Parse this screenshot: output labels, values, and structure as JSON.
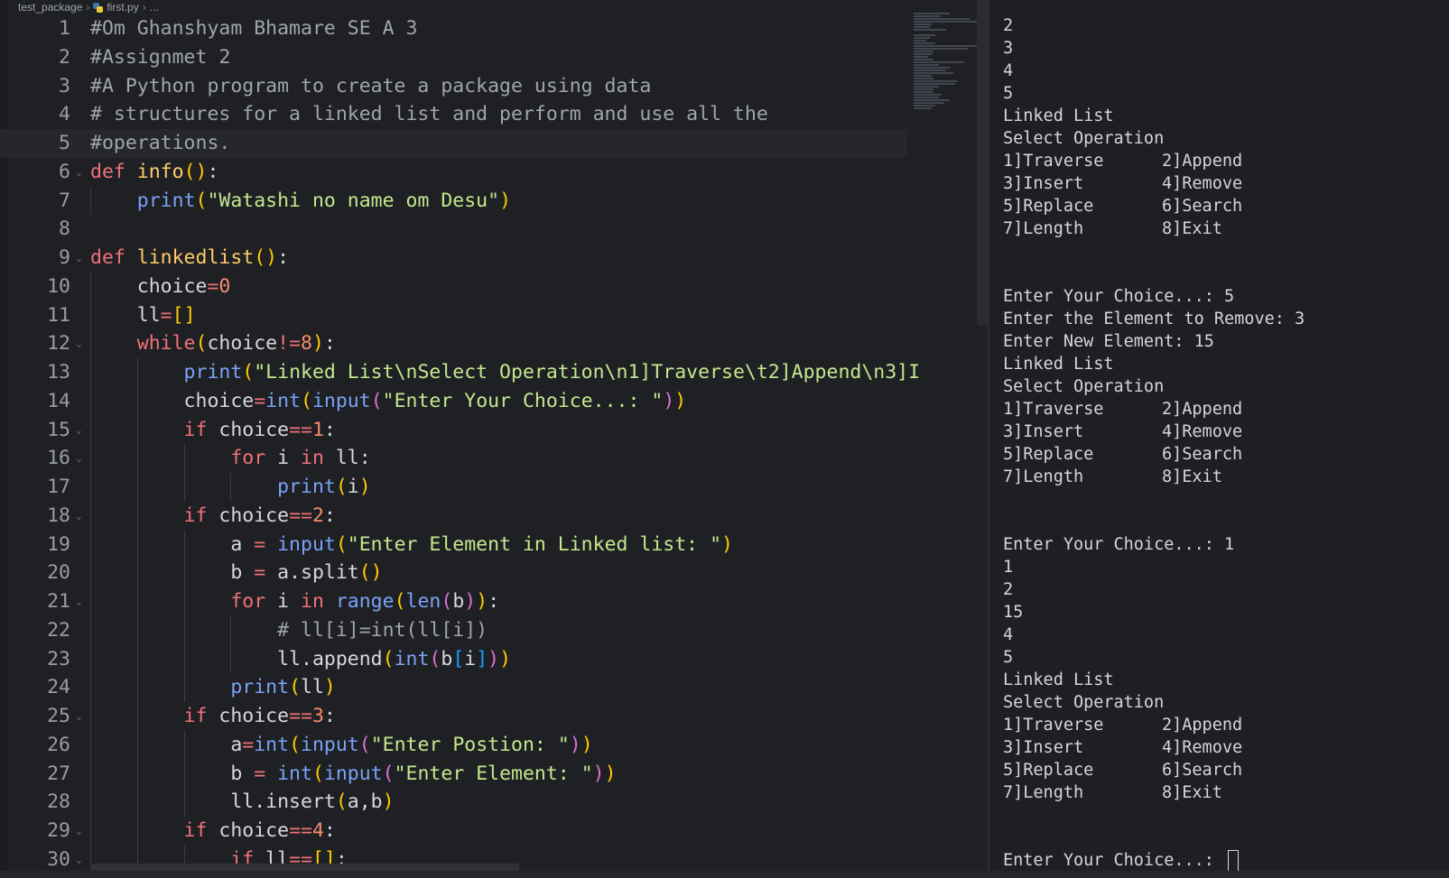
{
  "breadcrumb": {
    "folder": "test_package",
    "file": "first.py",
    "more": "..."
  },
  "colors": {
    "editor_bg": "#1f2024",
    "keyword": "#f07178",
    "function": "#ffcc66",
    "builtin": "#7aa2f7",
    "string": "#c3e88d",
    "number": "#f78c6c",
    "comment": "#a0a4ad"
  },
  "code_lines": [
    {
      "n": "1",
      "tokens": [
        {
          "t": "#Om Ghanshyam Bhamare SE A 3",
          "c": "cm"
        }
      ]
    },
    {
      "n": "2",
      "tokens": [
        {
          "t": "#Assignmet 2",
          "c": "cm"
        }
      ]
    },
    {
      "n": "3",
      "tokens": [
        {
          "t": "#A Python program to create a package using data",
          "c": "cm"
        }
      ]
    },
    {
      "n": "4",
      "tokens": [
        {
          "t": "# structures for a linked list and perform and use all the",
          "c": "cm"
        }
      ]
    },
    {
      "n": "5",
      "current": true,
      "tokens": [
        {
          "t": "#operations.",
          "c": "cm"
        }
      ]
    },
    {
      "n": "6",
      "fold": true,
      "tokens": [
        {
          "t": "def ",
          "c": "kw"
        },
        {
          "t": "info",
          "c": "fn"
        },
        {
          "t": "()",
          "c": "p1"
        },
        {
          "t": ":",
          "c": ""
        }
      ]
    },
    {
      "n": "7",
      "indent": 1,
      "tokens": [
        {
          "t": "    print",
          "c": "bi"
        },
        {
          "t": "(",
          "c": "p1"
        },
        {
          "t": "\"Watashi no name om Desu\"",
          "c": "st"
        },
        {
          "t": ")",
          "c": "p1"
        }
      ]
    },
    {
      "n": "8",
      "tokens": []
    },
    {
      "n": "9",
      "fold": true,
      "tokens": [
        {
          "t": "def ",
          "c": "kw"
        },
        {
          "t": "linkedlist",
          "c": "fn"
        },
        {
          "t": "()",
          "c": "p1"
        },
        {
          "t": ":",
          "c": ""
        }
      ]
    },
    {
      "n": "10",
      "indent": 1,
      "tokens": [
        {
          "t": "    choice",
          "c": ""
        },
        {
          "t": "=",
          "c": "op"
        },
        {
          "t": "0",
          "c": "num"
        }
      ]
    },
    {
      "n": "11",
      "indent": 1,
      "tokens": [
        {
          "t": "    ll",
          "c": ""
        },
        {
          "t": "=",
          "c": "op"
        },
        {
          "t": "[]",
          "c": "p1"
        }
      ]
    },
    {
      "n": "12",
      "indent": 1,
      "fold": true,
      "tokens": [
        {
          "t": "    while",
          "c": "kw"
        },
        {
          "t": "(",
          "c": "p1"
        },
        {
          "t": "choice",
          "c": ""
        },
        {
          "t": "!=",
          "c": "op"
        },
        {
          "t": "8",
          "c": "num"
        },
        {
          "t": ")",
          "c": "p1"
        },
        {
          "t": ":",
          "c": ""
        }
      ]
    },
    {
      "n": "13",
      "indent": 2,
      "tokens": [
        {
          "t": "        print",
          "c": "bi"
        },
        {
          "t": "(",
          "c": "p1"
        },
        {
          "t": "\"Linked List\\nSelect Operation\\n1]Traverse\\t2]Append\\n3]I",
          "c": "st"
        }
      ]
    },
    {
      "n": "14",
      "indent": 2,
      "tokens": [
        {
          "t": "        choice",
          "c": ""
        },
        {
          "t": "=",
          "c": "op"
        },
        {
          "t": "int",
          "c": "bi"
        },
        {
          "t": "(",
          "c": "p1"
        },
        {
          "t": "input",
          "c": "bi"
        },
        {
          "t": "(",
          "c": "p2"
        },
        {
          "t": "\"Enter Your Choice...: \"",
          "c": "st"
        },
        {
          "t": ")",
          "c": "p2"
        },
        {
          "t": ")",
          "c": "p1"
        }
      ]
    },
    {
      "n": "15",
      "indent": 2,
      "fold": true,
      "tokens": [
        {
          "t": "        if ",
          "c": "kw"
        },
        {
          "t": "choice",
          "c": ""
        },
        {
          "t": "==",
          "c": "op"
        },
        {
          "t": "1",
          "c": "num"
        },
        {
          "t": ":",
          "c": ""
        }
      ]
    },
    {
      "n": "16",
      "indent": 3,
      "fold": true,
      "tokens": [
        {
          "t": "            for ",
          "c": "kw"
        },
        {
          "t": "i ",
          "c": ""
        },
        {
          "t": "in ",
          "c": "kw"
        },
        {
          "t": "ll:",
          "c": ""
        }
      ]
    },
    {
      "n": "17",
      "indent": 4,
      "tokens": [
        {
          "t": "                print",
          "c": "bi"
        },
        {
          "t": "(",
          "c": "p1"
        },
        {
          "t": "i",
          "c": ""
        },
        {
          "t": ")",
          "c": "p1"
        }
      ]
    },
    {
      "n": "18",
      "indent": 2,
      "fold": true,
      "tokens": [
        {
          "t": "        if ",
          "c": "kw"
        },
        {
          "t": "choice",
          "c": ""
        },
        {
          "t": "==",
          "c": "op"
        },
        {
          "t": "2",
          "c": "num"
        },
        {
          "t": ":",
          "c": ""
        }
      ]
    },
    {
      "n": "19",
      "indent": 3,
      "tokens": [
        {
          "t": "            a ",
          "c": ""
        },
        {
          "t": "= ",
          "c": "op"
        },
        {
          "t": "input",
          "c": "bi"
        },
        {
          "t": "(",
          "c": "p1"
        },
        {
          "t": "\"Enter Element in Linked list: \"",
          "c": "st"
        },
        {
          "t": ")",
          "c": "p1"
        }
      ]
    },
    {
      "n": "20",
      "indent": 3,
      "tokens": [
        {
          "t": "            b ",
          "c": ""
        },
        {
          "t": "= ",
          "c": "op"
        },
        {
          "t": "a.split",
          "c": ""
        },
        {
          "t": "()",
          "c": "p1"
        }
      ]
    },
    {
      "n": "21",
      "indent": 3,
      "fold": true,
      "tokens": [
        {
          "t": "            for ",
          "c": "kw"
        },
        {
          "t": "i ",
          "c": ""
        },
        {
          "t": "in ",
          "c": "kw"
        },
        {
          "t": "range",
          "c": "bi"
        },
        {
          "t": "(",
          "c": "p1"
        },
        {
          "t": "len",
          "c": "bi"
        },
        {
          "t": "(",
          "c": "p2"
        },
        {
          "t": "b",
          "c": ""
        },
        {
          "t": ")",
          "c": "p2"
        },
        {
          "t": ")",
          "c": "p1"
        },
        {
          "t": ":",
          "c": ""
        }
      ]
    },
    {
      "n": "22",
      "indent": 4,
      "tokens": [
        {
          "t": "                # ll[i]=int(ll[i])",
          "c": "cm"
        }
      ]
    },
    {
      "n": "23",
      "indent": 4,
      "tokens": [
        {
          "t": "                ll.append",
          "c": ""
        },
        {
          "t": "(",
          "c": "p1"
        },
        {
          "t": "int",
          "c": "bi"
        },
        {
          "t": "(",
          "c": "p2"
        },
        {
          "t": "b",
          "c": ""
        },
        {
          "t": "[",
          "c": "p3"
        },
        {
          "t": "i",
          "c": ""
        },
        {
          "t": "]",
          "c": "p3"
        },
        {
          "t": ")",
          "c": "p2"
        },
        {
          "t": ")",
          "c": "p1"
        }
      ]
    },
    {
      "n": "24",
      "indent": 3,
      "tokens": [
        {
          "t": "            print",
          "c": "bi"
        },
        {
          "t": "(",
          "c": "p1"
        },
        {
          "t": "ll",
          "c": ""
        },
        {
          "t": ")",
          "c": "p1"
        }
      ]
    },
    {
      "n": "25",
      "indent": 2,
      "fold": true,
      "tokens": [
        {
          "t": "        if ",
          "c": "kw"
        },
        {
          "t": "choice",
          "c": ""
        },
        {
          "t": "==",
          "c": "op"
        },
        {
          "t": "3",
          "c": "num"
        },
        {
          "t": ":",
          "c": ""
        }
      ]
    },
    {
      "n": "26",
      "indent": 3,
      "tokens": [
        {
          "t": "            a",
          "c": ""
        },
        {
          "t": "=",
          "c": "op"
        },
        {
          "t": "int",
          "c": "bi"
        },
        {
          "t": "(",
          "c": "p1"
        },
        {
          "t": "input",
          "c": "bi"
        },
        {
          "t": "(",
          "c": "p2"
        },
        {
          "t": "\"Enter Postion: \"",
          "c": "st"
        },
        {
          "t": ")",
          "c": "p2"
        },
        {
          "t": ")",
          "c": "p1"
        }
      ]
    },
    {
      "n": "27",
      "indent": 3,
      "tokens": [
        {
          "t": "            b ",
          "c": ""
        },
        {
          "t": "= ",
          "c": "op"
        },
        {
          "t": "int",
          "c": "bi"
        },
        {
          "t": "(",
          "c": "p1"
        },
        {
          "t": "input",
          "c": "bi"
        },
        {
          "t": "(",
          "c": "p2"
        },
        {
          "t": "\"Enter Element: \"",
          "c": "st"
        },
        {
          "t": ")",
          "c": "p2"
        },
        {
          "t": ")",
          "c": "p1"
        }
      ]
    },
    {
      "n": "28",
      "indent": 3,
      "tokens": [
        {
          "t": "            ll.insert",
          "c": ""
        },
        {
          "t": "(",
          "c": "p1"
        },
        {
          "t": "a,b",
          "c": ""
        },
        {
          "t": ")",
          "c": "p1"
        }
      ]
    },
    {
      "n": "29",
      "indent": 2,
      "fold": true,
      "tokens": [
        {
          "t": "        if ",
          "c": "kw"
        },
        {
          "t": "choice",
          "c": ""
        },
        {
          "t": "==",
          "c": "op"
        },
        {
          "t": "4",
          "c": "num"
        },
        {
          "t": ":",
          "c": ""
        }
      ]
    },
    {
      "n": "30",
      "indent": 3,
      "fold": true,
      "tokens": [
        {
          "t": "            if ",
          "c": "kw"
        },
        {
          "t": "ll",
          "c": ""
        },
        {
          "t": "==",
          "c": "op"
        },
        {
          "t": "[]",
          "c": "p1"
        },
        {
          "t": ":",
          "c": ""
        }
      ]
    }
  ],
  "terminal_lines": [
    "2",
    "3",
    "4",
    "5",
    "Linked List",
    "Select Operation",
    "1]Traverse\t2]Append",
    "3]Insert\t4]Remove",
    "5]Replace\t6]Search",
    "7]Length\t8]Exit",
    "",
    "",
    "Enter Your Choice...: 5",
    "Enter the Element to Remove: 3",
    "Enter New Element: 15",
    "Linked List",
    "Select Operation",
    "1]Traverse\t2]Append",
    "3]Insert\t4]Remove",
    "5]Replace\t6]Search",
    "7]Length\t8]Exit",
    "",
    "",
    "Enter Your Choice...: 1",
    "1",
    "2",
    "15",
    "4",
    "5",
    "Linked List",
    "Select Operation",
    "1]Traverse\t2]Append",
    "3]Insert\t4]Remove",
    "5]Replace\t6]Search",
    "7]Length\t8]Exit",
    "",
    "",
    "Enter Your Choice...: "
  ]
}
